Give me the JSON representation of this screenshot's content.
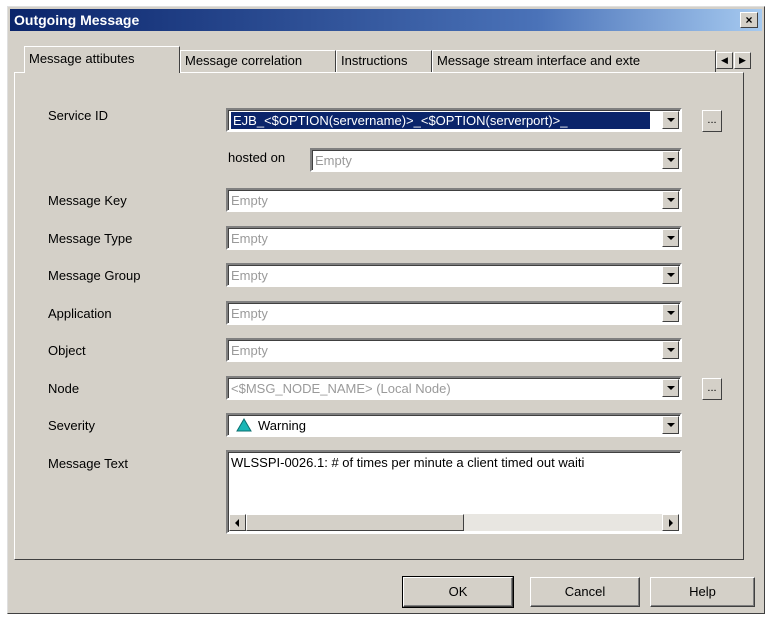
{
  "window": {
    "title": "Outgoing Message",
    "close_glyph": "×"
  },
  "tabs": [
    {
      "label": "Message attibutes",
      "active": true
    },
    {
      "label": "Message correlation",
      "active": false
    },
    {
      "label": "Instructions",
      "active": false
    },
    {
      "label": "Message stream interface and exte",
      "active": false
    }
  ],
  "tab_scroll": {
    "left_icon": "arrow-left-icon",
    "right_icon": "arrow-right-icon"
  },
  "fields": {
    "service_id": {
      "label": "Service ID",
      "value": "EJB_<$OPTION(servername)>_<$OPTION(serverport)>_"
    },
    "hosted_on": {
      "label": "hosted on",
      "value": "Empty"
    },
    "message_key": {
      "label": "Message Key",
      "value": "Empty"
    },
    "message_type": {
      "label": "Message Type",
      "value": "Empty"
    },
    "message_group": {
      "label": "Message Group",
      "value": "Empty"
    },
    "application": {
      "label": "Application",
      "value": "Empty"
    },
    "object": {
      "label": "Object",
      "value": "Empty"
    },
    "node": {
      "label": "Node",
      "value": "<$MSG_NODE_NAME> (Local Node)"
    },
    "severity": {
      "label": "Severity",
      "value": "Warning",
      "icon": "warning-triangle-icon",
      "icon_color": "#19b6b6"
    },
    "message_text": {
      "label": "Message Text",
      "value": "WLSSPI-0026.1: # of times per minute a client timed out waiti"
    }
  },
  "browse_label": "...",
  "buttons": {
    "ok": "OK",
    "cancel": "Cancel",
    "help": "Help"
  },
  "colors": {
    "dialog_bg": "#d4d0c8",
    "title_bar": "#0a246a",
    "selection": "#0a246a"
  }
}
